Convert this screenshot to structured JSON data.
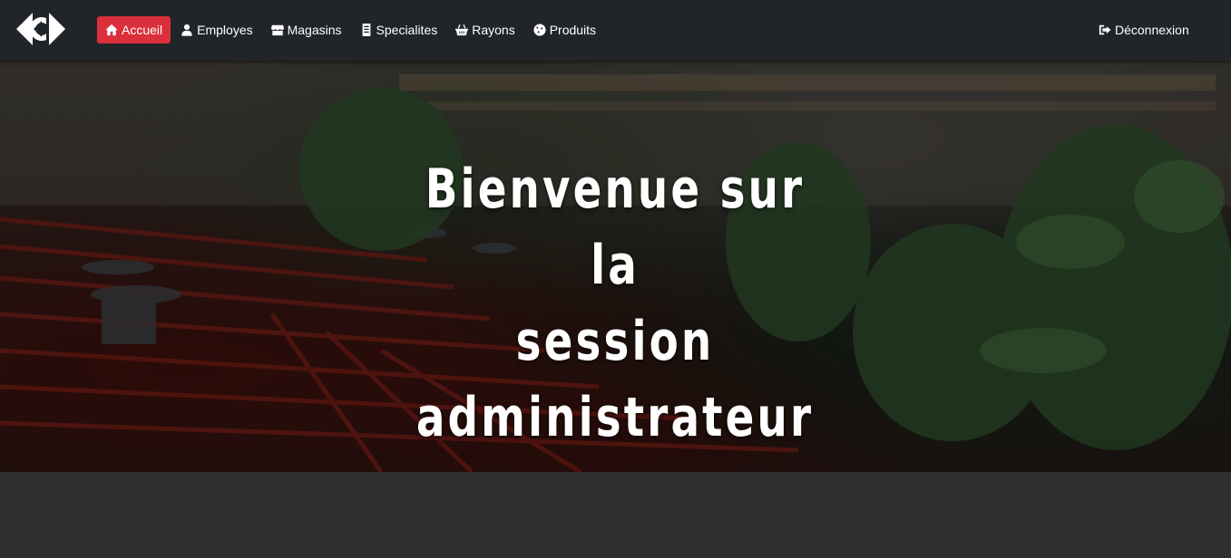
{
  "navbar": {
    "brand_icon": "carrefour-logo",
    "items": [
      {
        "label": "Accueil",
        "icon": "home-icon",
        "active": true
      },
      {
        "label": "Employes",
        "icon": "user-icon",
        "active": false
      },
      {
        "label": "Magasins",
        "icon": "store-icon",
        "active": false
      },
      {
        "label": "Specialites",
        "icon": "list-icon",
        "active": false
      },
      {
        "label": "Rayons",
        "icon": "basket-icon",
        "active": false
      },
      {
        "label": "Produits",
        "icon": "cookie-icon",
        "active": false
      }
    ],
    "logout": {
      "label": "Déconnexion",
      "icon": "sign-out-icon"
    }
  },
  "hero": {
    "title_lines": [
      "Bienvenue sur la",
      "session",
      "administrateur"
    ]
  },
  "colors": {
    "navbar_bg": "#212529",
    "active_bg": "#dc2f3c",
    "page_bg": "#2f2f2f",
    "text": "#ffffff"
  }
}
